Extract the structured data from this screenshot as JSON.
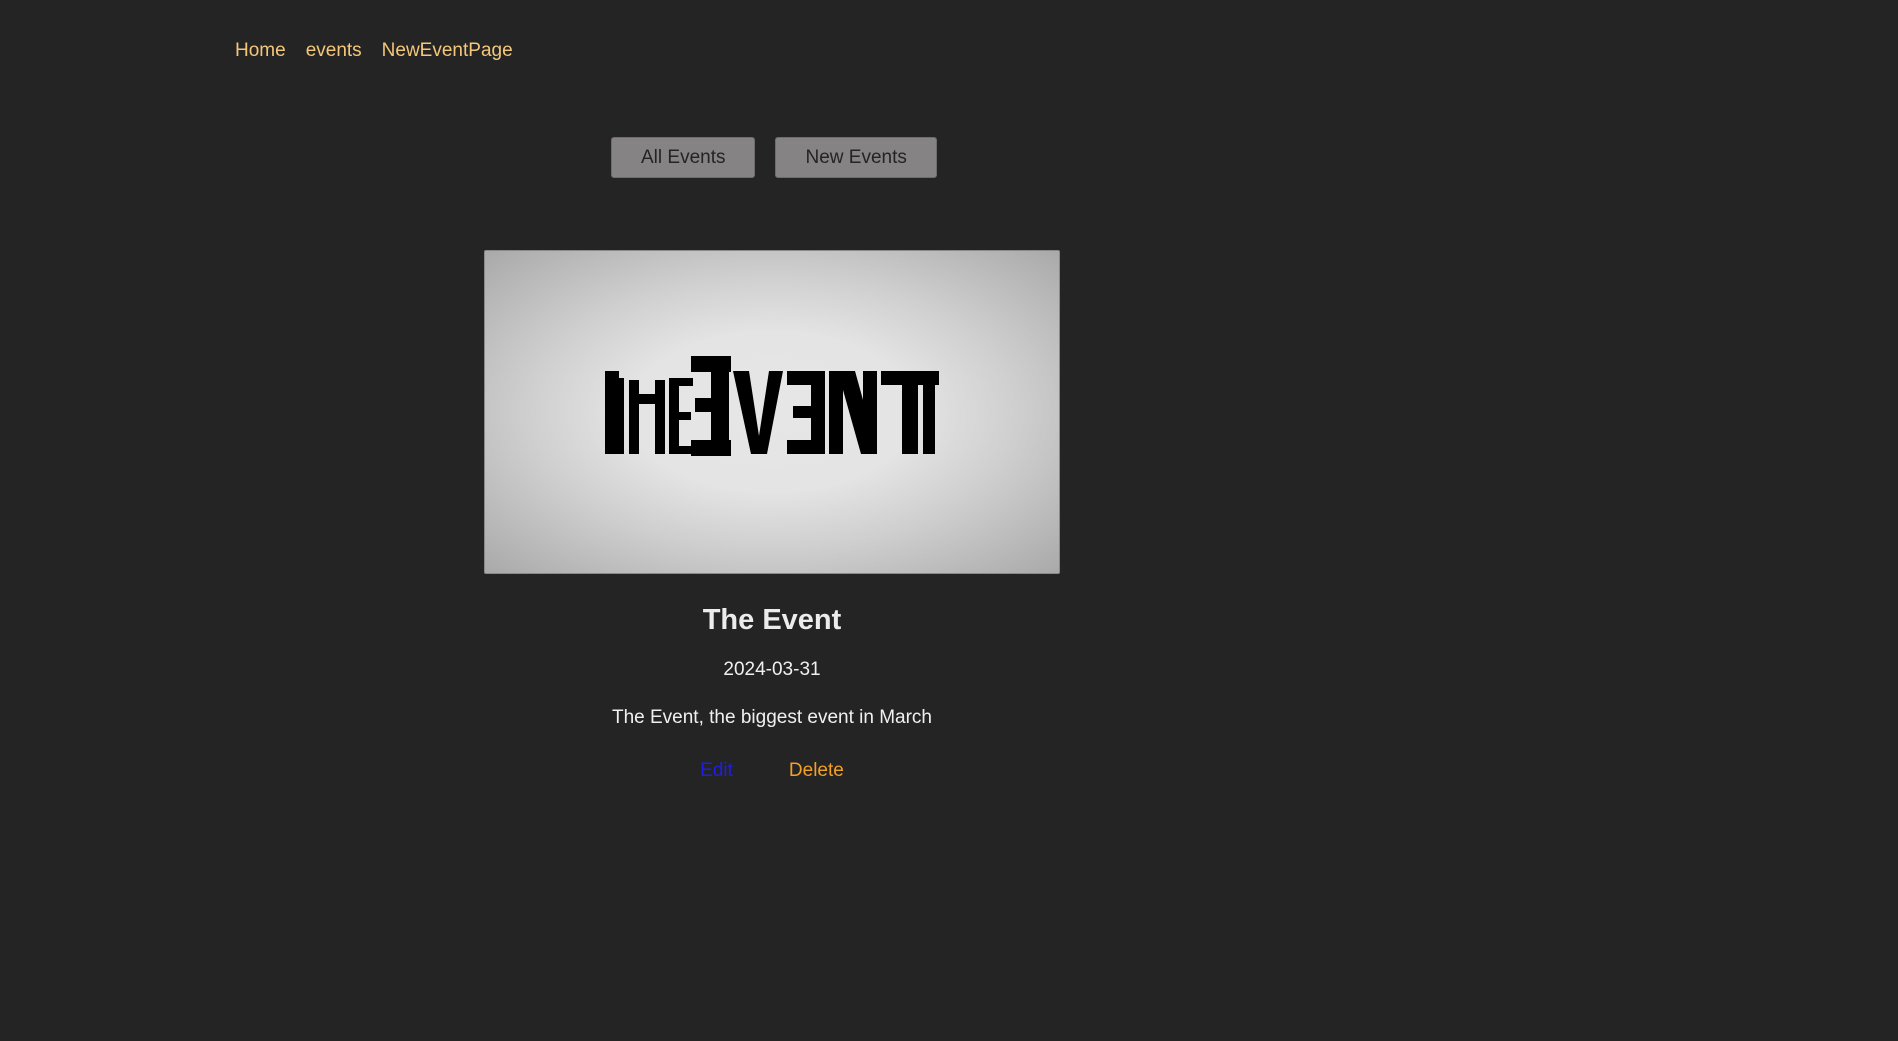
{
  "nav": {
    "items": [
      {
        "label": "Home"
      },
      {
        "label": "events"
      },
      {
        "label": "NewEventPage"
      }
    ]
  },
  "subnav": {
    "all_events": "All Events",
    "new_events": "New Events"
  },
  "event": {
    "image_logo_text": "THE EVENT",
    "title": "The Event",
    "date": "2024-03-31",
    "description": "The Event, the biggest event in March",
    "edit_label": "Edit",
    "delete_label": "Delete"
  },
  "colors": {
    "background": "#242424",
    "nav_link": "#f4c77a",
    "button_bg": "#858383",
    "edit_link": "#1e1ee6",
    "delete_link": "#f3a027"
  }
}
